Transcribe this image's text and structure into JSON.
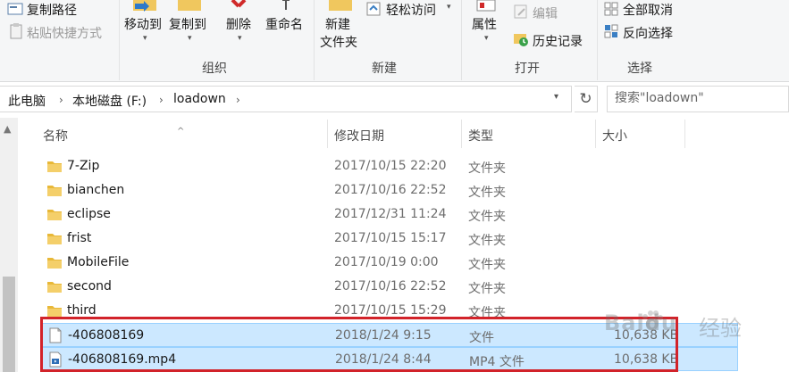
{
  "ribbon": {
    "clipboard": {
      "copy_path": "复制路径",
      "paste_shortcut": "粘贴快捷方式"
    },
    "organize": {
      "move_to": "移动到",
      "copy_to": "复制到",
      "delete": "删除",
      "rename": "重命名",
      "label": "组织"
    },
    "new": {
      "new_folder_line1": "新建",
      "new_folder_line2": "文件夹",
      "easy_access": "轻松访问",
      "label": "新建"
    },
    "open": {
      "properties": "属性",
      "edit": "编辑",
      "history": "历史记录",
      "label": "打开"
    },
    "select": {
      "select_none": "全部取消",
      "invert": "反向选择",
      "label": "选择"
    }
  },
  "address": {
    "crumbs": [
      "此电脑",
      "本地磁盘 (F:)",
      "loadown"
    ],
    "search_placeholder": "搜索\"loadown\""
  },
  "columns": {
    "name": "名称",
    "date": "修改日期",
    "type": "类型",
    "size": "大小"
  },
  "files": [
    {
      "name": "7-Zip",
      "date": "2017/10/15 22:20",
      "type": "文件夹",
      "size": "",
      "icon": "folder-icon",
      "selected": false
    },
    {
      "name": "bianchen",
      "date": "2017/10/16 22:52",
      "type": "文件夹",
      "size": "",
      "icon": "folder-icon",
      "selected": false
    },
    {
      "name": "eclipse",
      "date": "2017/12/31 11:24",
      "type": "文件夹",
      "size": "",
      "icon": "folder-icon",
      "selected": false
    },
    {
      "name": "frist",
      "date": "2017/10/15 15:17",
      "type": "文件夹",
      "size": "",
      "icon": "folder-icon",
      "selected": false
    },
    {
      "name": "MobileFile",
      "date": "2017/10/19 0:00",
      "type": "文件夹",
      "size": "",
      "icon": "folder-icon",
      "selected": false
    },
    {
      "name": "second",
      "date": "2017/10/16 22:52",
      "type": "文件夹",
      "size": "",
      "icon": "folder-icon",
      "selected": false
    },
    {
      "name": "third",
      "date": "2017/10/15 15:29",
      "type": "文件夹",
      "size": "",
      "icon": "folder-icon",
      "selected": false
    },
    {
      "name": "-406808169",
      "date": "2018/1/24 9:15",
      "type": "文件",
      "size": "10,638 KB",
      "icon": "file-icon",
      "selected": true
    },
    {
      "name": "-406808169.mp4",
      "date": "2018/1/24 8:44",
      "type": "MP4 文件",
      "size": "10,638 KB",
      "icon": "video-file-icon",
      "selected": true
    }
  ],
  "watermark": {
    "brand": "Baidu",
    "suffix": "经验"
  },
  "colors": {
    "selection": "#cce8ff",
    "selection_border": "#99d1ff",
    "highlight": "#d2232a",
    "folder": "#e8b838"
  }
}
